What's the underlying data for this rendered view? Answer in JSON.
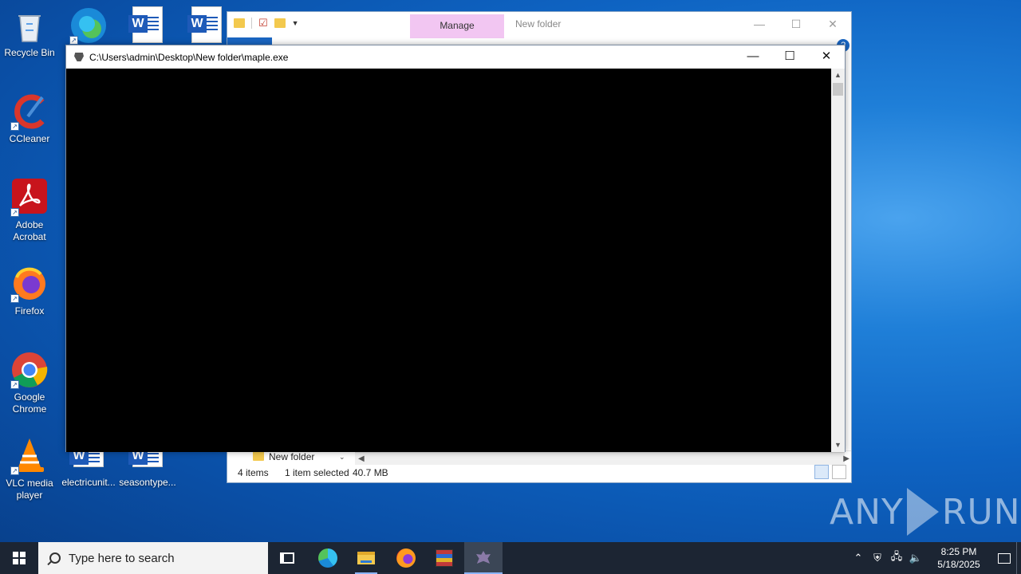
{
  "desktop": {
    "icons": [
      {
        "label": "Recycle Bin",
        "icon": "recycle-bin-icon"
      },
      {
        "label": "CCleaner",
        "icon": "ccleaner-icon"
      },
      {
        "label": "Adobe Acrobat",
        "icon": "acrobat-icon"
      },
      {
        "label": "Firefox",
        "icon": "firefox-icon"
      },
      {
        "label": "Google Chrome",
        "icon": "chrome-icon"
      },
      {
        "label": "VLC media player",
        "icon": "vlc-icon"
      },
      {
        "label": "electricunit...",
        "icon": "word-doc-icon"
      },
      {
        "label": "seasontype...",
        "icon": "word-doc-icon"
      }
    ]
  },
  "explorer": {
    "title": "New folder",
    "manage_tab": "Manage",
    "nav_folder": "New folder",
    "status": {
      "items": "4 items",
      "selected": "1 item selected",
      "size": "40.7 MB"
    }
  },
  "console": {
    "title": "C:\\Users\\admin\\Desktop\\New folder\\maple.exe",
    "minimize": "—",
    "maximize": "☐",
    "close": "✕"
  },
  "watermark": {
    "left": "ANY",
    "right": "RUN"
  },
  "taskbar": {
    "search_placeholder": "Type here to search",
    "apps": [
      "task-view",
      "edge",
      "file-explorer",
      "firefox",
      "winrar",
      "maple"
    ],
    "clock_time": "8:25 PM",
    "clock_date": "5/18/2025"
  },
  "colors": {
    "desktop_bg": "#0e63c2",
    "taskbar_bg": "#1c2533",
    "manage_tab": "#f2c6f2",
    "console_bg": "#000000"
  }
}
